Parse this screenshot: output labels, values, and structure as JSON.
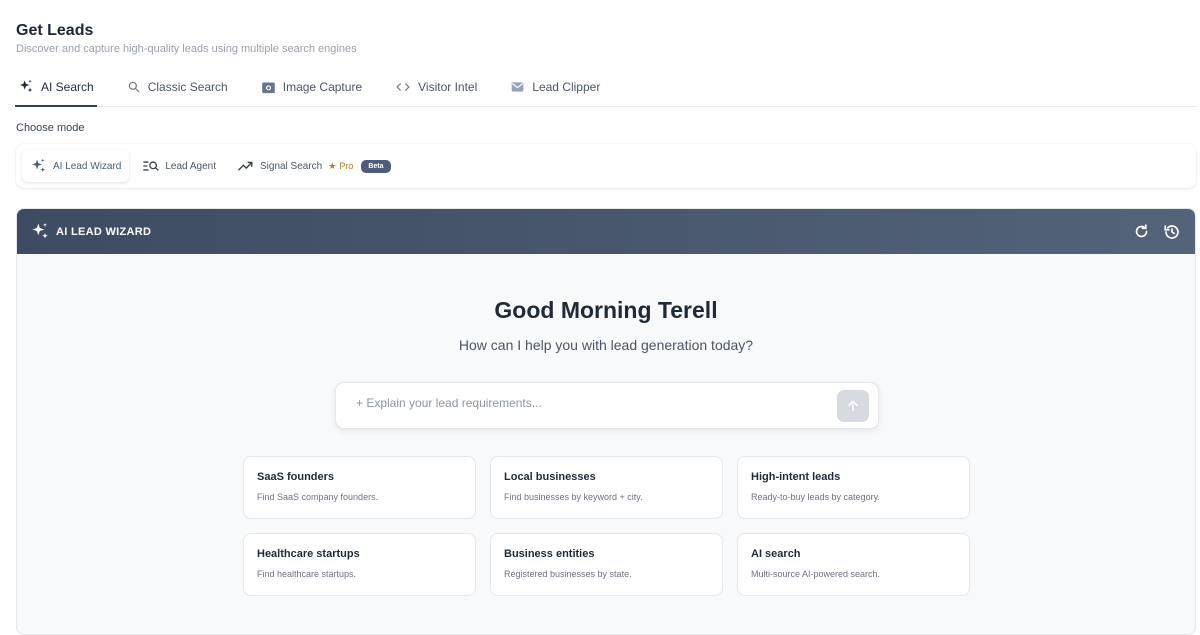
{
  "header": {
    "title": "Get Leads",
    "subtitle": "Discover and capture high-quality leads using multiple search engines"
  },
  "tabs": [
    {
      "label": "AI Search",
      "icon": "sparkle-icon",
      "active": true
    },
    {
      "label": "Classic Search",
      "icon": "search-icon"
    },
    {
      "label": "Image Capture",
      "icon": "camera-icon"
    },
    {
      "label": "Visitor Intel",
      "icon": "code-icon"
    },
    {
      "label": "Lead Clipper",
      "icon": "mail-icon"
    }
  ],
  "mode": {
    "label": "Choose mode",
    "options": [
      {
        "label": "AI Lead Wizard",
        "icon": "sparkle-icon",
        "active": true
      },
      {
        "label": "Lead Agent",
        "icon": "list-search-icon"
      },
      {
        "label": "Signal Search",
        "icon": "trending-up-icon"
      }
    ],
    "pro_label": "Pro",
    "beta_label": "Beta"
  },
  "wizard": {
    "title": "AI LEAD WIZARD",
    "greeting": "Good Morning Terell",
    "subtitle": "How can I help you with lead generation today?",
    "input_placeholder": "+ Explain your lead requirements...",
    "cards": [
      {
        "title": "SaaS founders",
        "desc": "Find SaaS company founders."
      },
      {
        "title": "Local businesses",
        "desc": "Find businesses by keyword + city."
      },
      {
        "title": "High-intent leads",
        "desc": "Ready-to-buy leads by category."
      },
      {
        "title": "Healthcare startups",
        "desc": "Find healthcare startups."
      },
      {
        "title": "Business entities",
        "desc": "Registered businesses by state."
      },
      {
        "title": "AI search",
        "desc": "Multi-source AI-powered search."
      }
    ]
  },
  "colors": {
    "accent": "#3d4b63",
    "pro": "#b7791f",
    "beta": "#4f5d7a"
  }
}
